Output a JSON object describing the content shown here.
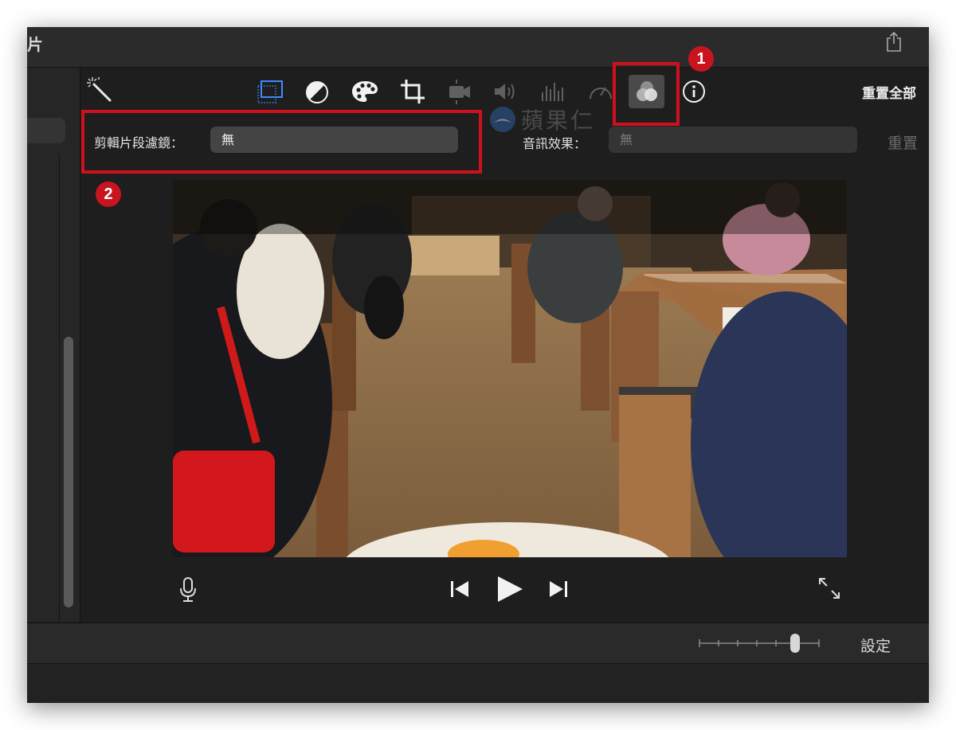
{
  "window": {
    "title_fragment": "片"
  },
  "toolbar": {
    "icons": [
      "magic-wand-icon",
      "crop-to-fill-icon",
      "color-balance-icon",
      "color-palette-icon",
      "crop-icon",
      "stabilization-icon",
      "volume-icon",
      "noise-eq-icon",
      "speed-icon",
      "clip-filter-icon",
      "info-icon"
    ],
    "reset_all": "重置全部",
    "active_icon": "clip-filter-icon"
  },
  "filter_row": {
    "clip_filter_label": "剪輯片段濾鏡：",
    "clip_filter_value": "無",
    "audio_effect_label": "音訊效果：",
    "audio_effect_value": "無",
    "reset": "重置"
  },
  "watermark": {
    "text": "蘋果仁"
  },
  "playback": {
    "icons": [
      "microphone-icon",
      "skip-back-icon",
      "play-icon",
      "skip-forward-icon",
      "fullscreen-icon"
    ]
  },
  "bottom_bar": {
    "settings": "設定"
  },
  "annotations": [
    {
      "label": "1"
    },
    {
      "label": "2"
    }
  ],
  "colors": {
    "accent_blue": "#3d8bff",
    "highlight_red": "#d0101c",
    "badge_red": "#c8141f"
  }
}
